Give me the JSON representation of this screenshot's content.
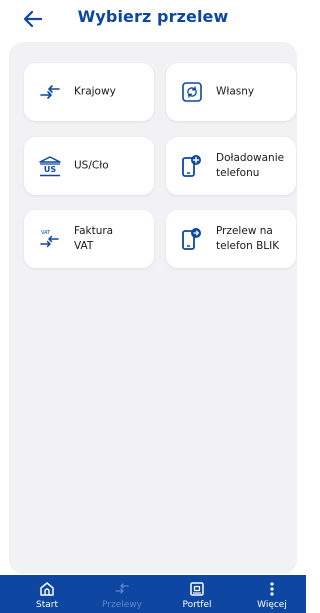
{
  "header": {
    "title": "Wybierz przelew"
  },
  "tiles": [
    {
      "label": "Krajowy",
      "icon": "transfer-arrows-icon"
    },
    {
      "label": "Własny",
      "icon": "own-transfer-icon"
    },
    {
      "label": "US/Cło",
      "icon": "tax-office-icon"
    },
    {
      "label": "Doładowanie telefonu",
      "icon": "phone-topup-icon"
    },
    {
      "label": "Faktura VAT",
      "icon": "vat-transfer-icon",
      "icon_text": "VAT"
    },
    {
      "label": "Przelew na telefon BLIK",
      "icon": "phone-blik-icon"
    }
  ],
  "tax_icon_text": "US",
  "bottom_nav": [
    {
      "label": "Start",
      "icon": "home-icon"
    },
    {
      "label": "Przelewy",
      "icon": "transfer-arrows-icon",
      "active": true
    },
    {
      "label": "Portfel",
      "icon": "wallet-icon"
    },
    {
      "label": "Więcej",
      "icon": "more-dots-icon"
    }
  ],
  "colors": {
    "primary": "#0d47a1",
    "panel_bg": "#f2f2f4",
    "inactive_nav": "#5f86c8"
  }
}
